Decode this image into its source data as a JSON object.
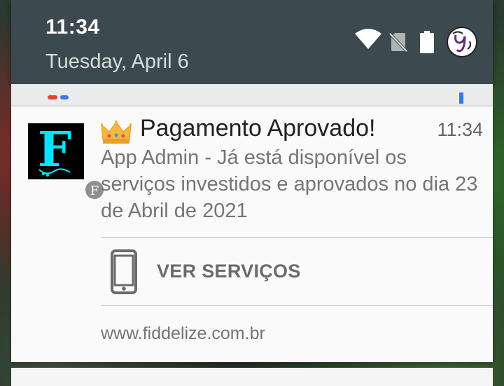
{
  "status_bar": {
    "time": "11:34",
    "date": "Tuesday, April 6",
    "icons": [
      "wifi-icon",
      "no-sim-icon",
      "battery-icon",
      "avatar"
    ]
  },
  "notification": {
    "app_badge": "F",
    "app_icon_letter": "F",
    "title_emoji": "👑",
    "title": "Pagamento Aprovado!",
    "time": "11:34",
    "body": "App Admin - Já está disponível os serviços investidos e aprovados no dia 23 de Abril de 2021",
    "action_label": "VER SERVIÇOS",
    "action_icon": "smartphone-icon",
    "footer_url": "www.fiddelize.com.br"
  },
  "colors": {
    "shade_bg": "#3c494f",
    "card_bg": "#fafafa",
    "app_icon_accent": "#00e5ff"
  }
}
